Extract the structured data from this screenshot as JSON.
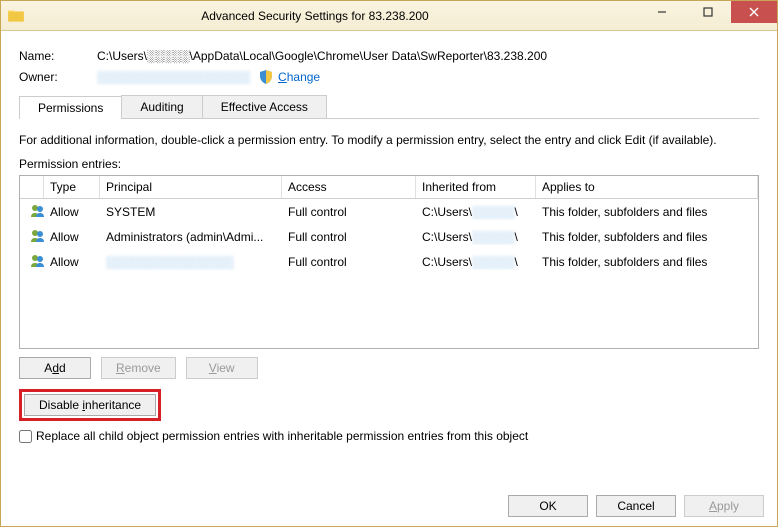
{
  "window": {
    "title": "Advanced Security Settings for 83.238.200"
  },
  "fields": {
    "name_label": "Name:",
    "name_value": "C:\\Users\\░░░░░\\AppData\\Local\\Google\\Chrome\\User Data\\SwReporter\\83.238.200",
    "owner_label": "Owner:",
    "owner_value": "░░░░░░░░░░░░░░░░░░",
    "change_link": "Change"
  },
  "tabs": {
    "permissions": "Permissions",
    "auditing": "Auditing",
    "effective": "Effective Access"
  },
  "info_text": "For additional information, double-click a permission entry. To modify a permission entry, select the entry and click Edit (if available).",
  "entries_label": "Permission entries:",
  "columns": {
    "icon": "",
    "type": "Type",
    "principal": "Principal",
    "access": "Access",
    "inherited": "Inherited from",
    "applies": "Applies to"
  },
  "rows": [
    {
      "type": "Allow",
      "principal": "SYSTEM",
      "access": "Full control",
      "inherited": "C:\\Users\\░░░░░\\",
      "applies": "This folder, subfolders and files"
    },
    {
      "type": "Allow",
      "principal": "Administrators (admin\\Admi...",
      "access": "Full control",
      "inherited": "C:\\Users\\░░░░░\\",
      "applies": "This folder, subfolders and files"
    },
    {
      "type": "Allow",
      "principal": "░░░░░░░░░░░░░░░",
      "access": "Full control",
      "inherited": "C:\\Users\\░░░░░\\",
      "applies": "This folder, subfolders and files"
    }
  ],
  "buttons": {
    "add": "Add",
    "remove": "Remove",
    "view": "View",
    "disable_inheritance": "Disable inheritance",
    "ok": "OK",
    "cancel": "Cancel",
    "apply": "Apply"
  },
  "checkbox_label": "Replace all child object permission entries with inheritable permission entries from this object"
}
